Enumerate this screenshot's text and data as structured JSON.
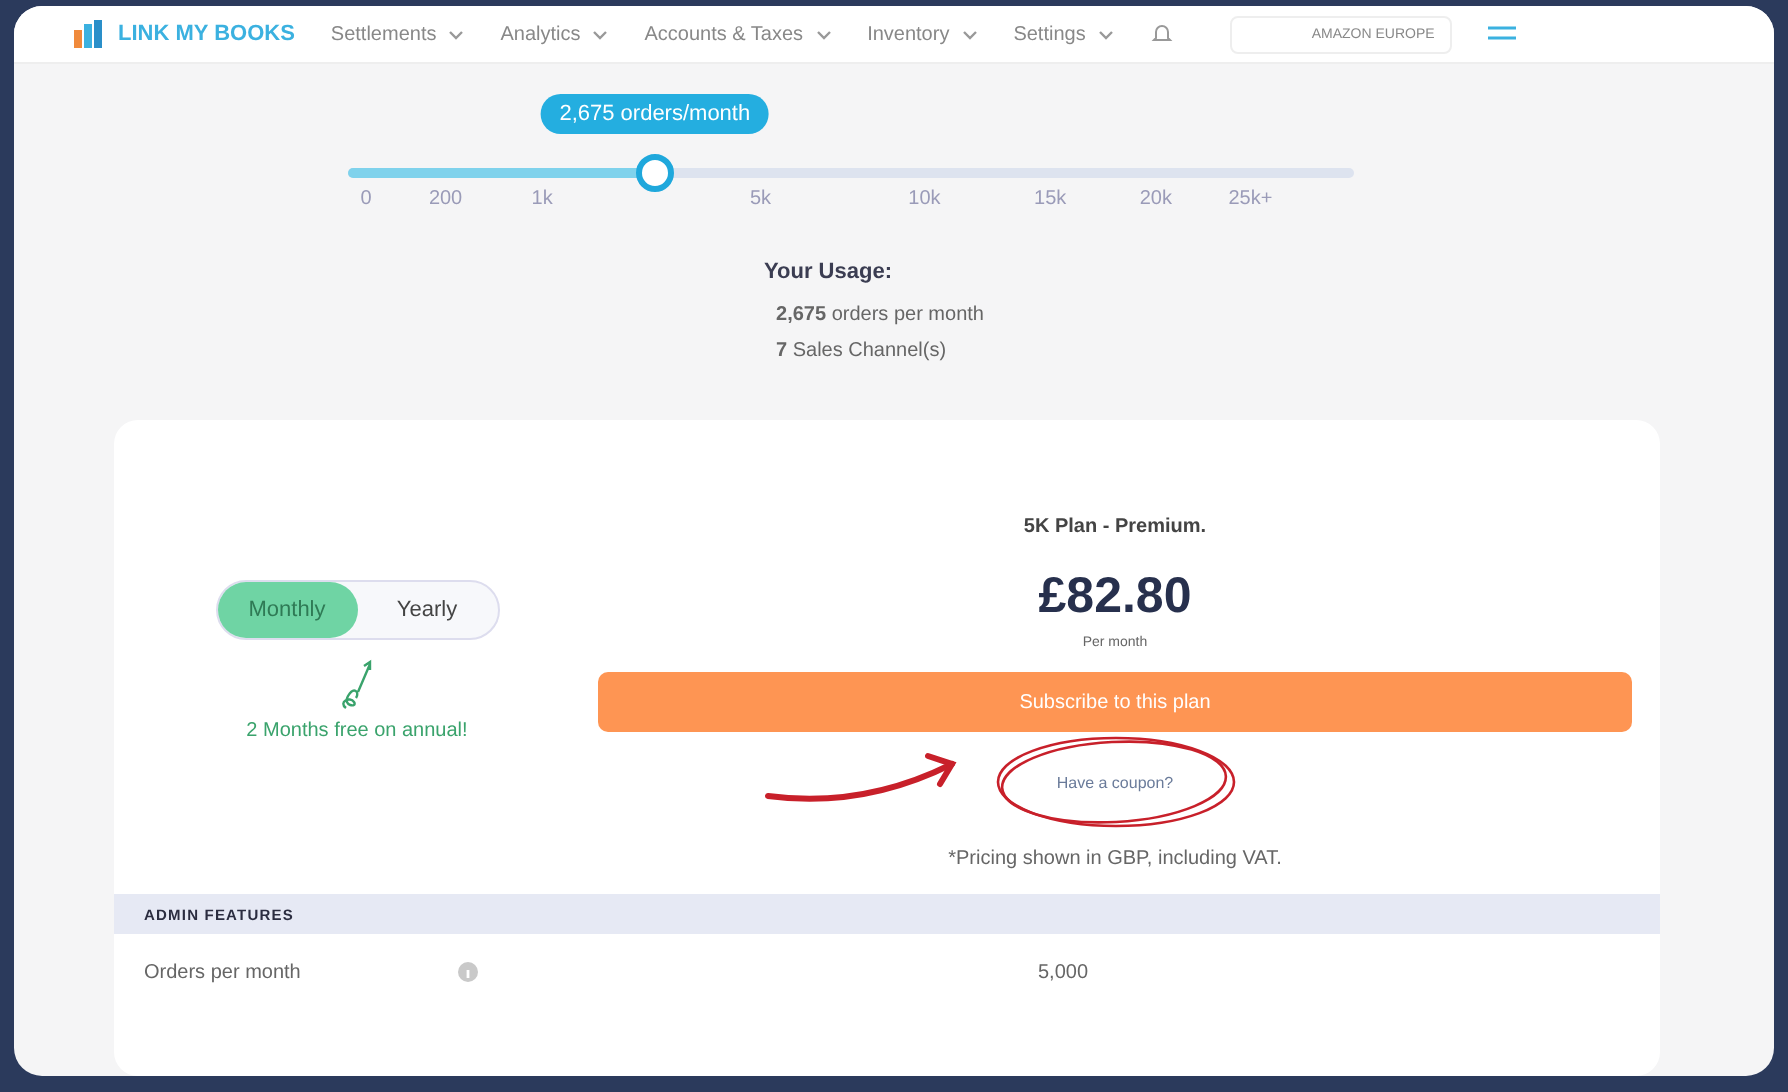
{
  "nav": {
    "logo": "LINK MY BOOKS",
    "items": [
      {
        "label": "Settlements"
      },
      {
        "label": "Analytics"
      },
      {
        "label": "Accounts & Taxes"
      },
      {
        "label": "Inventory"
      },
      {
        "label": "Settings"
      }
    ],
    "account": "AMAZON EUROPE"
  },
  "slider": {
    "bubble": "2,675 orders/month",
    "level": 0.305,
    "ticks": [
      "0",
      "200",
      "1k",
      "5k",
      "10k",
      "15k",
      "20k",
      "25k+"
    ]
  },
  "usage": {
    "title": "Your Usage:",
    "lines": [
      "**2,675** orders per month",
      "**7** Sales Channel(s)"
    ]
  },
  "billing": {
    "options": [
      {
        "label": "Monthly",
        "selected": true
      },
      {
        "label": "Yearly",
        "selected": false
      }
    ],
    "promo": "2 Months free on annual!"
  },
  "plan": {
    "name": "5K Plan - Premium.",
    "price": "£82.80",
    "period": "Per month",
    "button": "Subscribe to this plan",
    "coupon": "Have a coupon?",
    "note": "*Pricing shown in GBP, including VAT."
  },
  "features": {
    "heading": "ADMIN FEATURES",
    "rows": [
      {
        "label": "Orders per month",
        "value": "5,000"
      }
    ]
  }
}
